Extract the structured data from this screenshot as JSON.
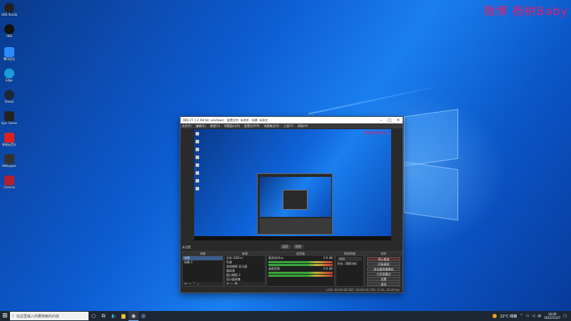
{
  "desktop": {
    "watermark": "微博 杨树Baby",
    "icons": [
      {
        "name": "app-icon-1",
        "label": "OBS Studio",
        "color": "#222"
      },
      {
        "name": "app-icon-2",
        "label": "OBS",
        "color": "#111"
      },
      {
        "name": "app-icon-3",
        "label": "腾讯会议",
        "color": "#2a8cff"
      },
      {
        "name": "app-icon-4",
        "label": "Edge",
        "color": "#1a9bd8"
      },
      {
        "name": "app-icon-5",
        "label": "Steam",
        "color": "#1b2838"
      },
      {
        "name": "app-icon-6",
        "label": "Epic Games",
        "color": "#222"
      },
      {
        "name": "app-icon-7",
        "label": "网易云音乐",
        "color": "#e02020"
      },
      {
        "name": "app-icon-8",
        "label": "Wallpaper",
        "color": "#333"
      },
      {
        "name": "app-icon-9",
        "label": "Camera",
        "color": "#b02030"
      }
    ]
  },
  "obs": {
    "title": "OBS 27.1.3 (64 bit, windows) - 配置文件: 未命名 - 场景: 未命名",
    "menu": [
      "文件(F)",
      "编辑(E)",
      "视图(V)",
      "停靠窗口(D)",
      "配置文件(P)",
      "场景集合(S)",
      "工具(T)",
      "帮助(H)"
    ],
    "preview_watermark": "微博 杨树Baby",
    "ctrl": [
      "混音",
      "音频"
    ],
    "scene_label": "未设置",
    "scenes_header": "场景",
    "scenes": [
      "场景",
      "场景 2"
    ],
    "sources_header": "来源",
    "sources": [
      "文本 (GDI+)",
      "色源",
      "游戏捕获 显示器",
      "媒体源",
      "窗口捕获 2",
      "显示器采集"
    ],
    "mixer_header": "混音器",
    "mixer": [
      {
        "label": "麦克风/Aux",
        "level": "0.0 dB"
      },
      {
        "label": "桌面音频",
        "level": "0.0 dB"
      }
    ],
    "transitions_header": "转场特效",
    "transition_type": "淡出",
    "duration_label": "时长",
    "duration_value": "300 ms",
    "controls_header": "控件",
    "controls": [
      "停止推流",
      "开始录制",
      "启动虚拟摄像机",
      "工作室模式",
      "设置",
      "退出"
    ],
    "status": "LIVE: 00:00:00   REC: 00:00:00   CPU: 0.4%, 30.00 fps"
  },
  "taskbar": {
    "search_placeholder": "在这里输入你要搜索的内容",
    "weather": "22°C 晴朗",
    "time": "16:09",
    "date": "2022/11/27"
  }
}
